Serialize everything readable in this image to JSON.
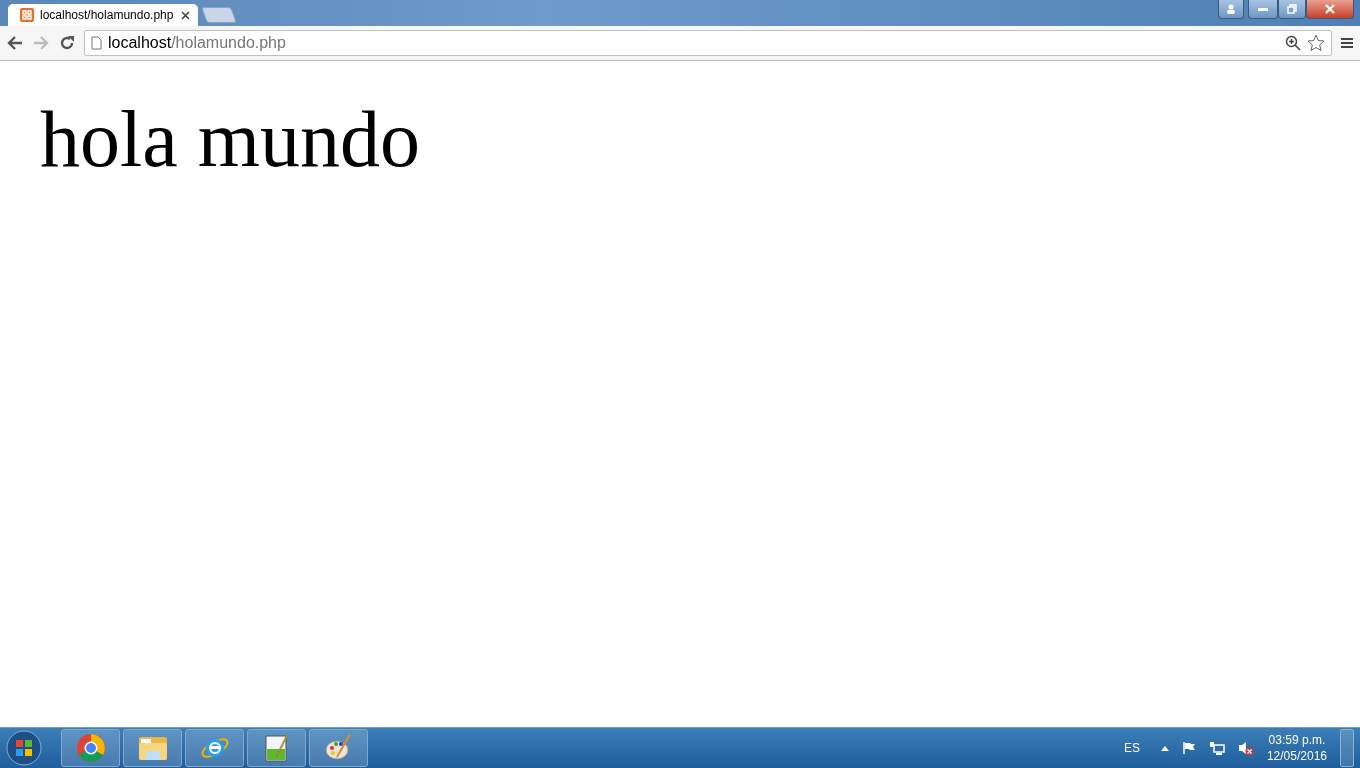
{
  "browser": {
    "tab": {
      "title": "localhost/holamundo.php"
    },
    "address": {
      "host": "localhost",
      "path": "/holamundo.php"
    }
  },
  "page": {
    "heading": "hola mundo"
  },
  "taskbar": {
    "apps": [
      {
        "kind": "chrome"
      },
      {
        "kind": "folder"
      },
      {
        "kind": "ie"
      },
      {
        "kind": "notepad"
      },
      {
        "kind": "paint"
      }
    ],
    "language": "ES",
    "time": "03:59 p.m.",
    "date": "12/05/2016"
  }
}
